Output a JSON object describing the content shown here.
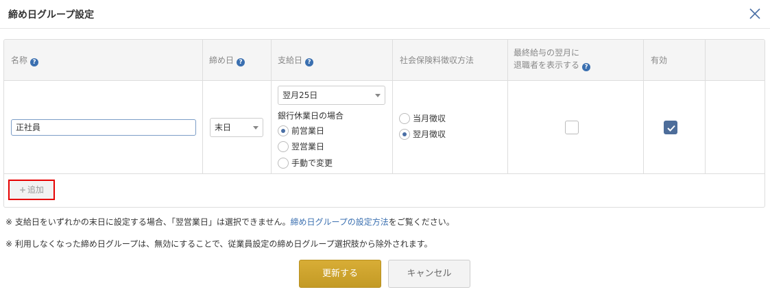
{
  "modal": {
    "title": "締め日グループ設定"
  },
  "table": {
    "headers": {
      "name": "名称",
      "closing_day": "締め日",
      "pay_day": "支給日",
      "social_insurance": "社会保険料徴収方法",
      "show_retired_line1": "最終給与の翌月に",
      "show_retired_line2": "退職者を表示する",
      "enabled": "有効"
    },
    "row": {
      "name_value": "正社員",
      "closing_day_value": "末日",
      "pay_day_value": "翌月25日",
      "bank_holiday_label": "銀行休業日の場合",
      "bank_holiday_options": [
        {
          "label": "前営業日",
          "selected": true
        },
        {
          "label": "翌営業日",
          "selected": false
        },
        {
          "label": "手動で変更",
          "selected": false
        }
      ],
      "insurance_options": [
        {
          "label": "当月徴収",
          "selected": false
        },
        {
          "label": "翌月徴収",
          "selected": true
        }
      ],
      "show_retired_checked": false,
      "enabled_checked": true
    },
    "add_label": "追加"
  },
  "notes": {
    "note1_prefix": "※ 支給日をいずれかの末日に設定する場合、「翌営業日」は選択できません。",
    "note1_link": "締め日グループの設定方法",
    "note1_suffix": "をご覧ください。",
    "note2": "※ 利用しなくなった締め日グループは、無効にすることで、従業員設定の締め日グループ選択肢から除外されます。"
  },
  "buttons": {
    "update": "更新する",
    "cancel": "キャンセル"
  },
  "colors": {
    "accent": "#c9a12c",
    "link": "#3a6fb0",
    "highlight": "#e60000",
    "checkbox": "#4d6d9a"
  }
}
